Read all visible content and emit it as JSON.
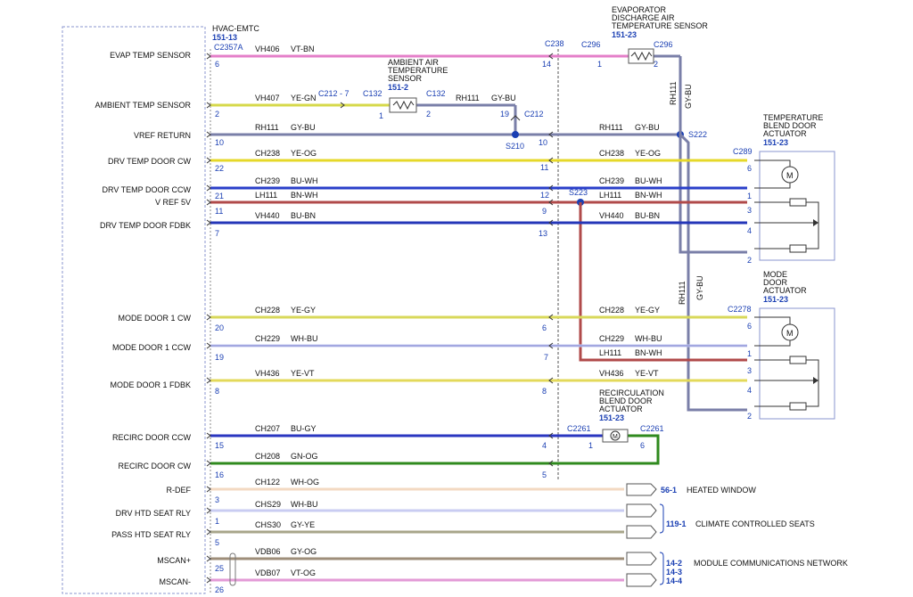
{
  "module": {
    "name": "HVAC-EMTC",
    "ref": "151-13",
    "connector": "C2357A",
    "labels": [
      "EVAP TEMP SENSOR",
      "AMBIENT TEMP SENSOR",
      "VREF RETURN",
      "DRV TEMP DOOR CW",
      "DRV TEMP DOOR CCW",
      "V REF 5V",
      "DRV TEMP DOOR FDBK",
      "MODE DOOR 1 CW",
      "MODE DOOR 1 CCW",
      "MODE DOOR 1 FDBK",
      "RECIRC DOOR CCW",
      "RECIRC DOOR CW",
      "R-DEF",
      "DRV HTD SEAT RLY",
      "PASS HTD SEAT RLY",
      "MSCAN+",
      "MSCAN-"
    ],
    "pins": [
      "6",
      "2",
      "10",
      "22",
      "21",
      "11",
      "7",
      "20",
      "19",
      "8",
      "15",
      "16",
      "3",
      "1",
      "5",
      "25",
      "26"
    ]
  },
  "wires": [
    {
      "circuit": "VH406",
      "color": "VT-BN",
      "hex": "#e47fc9"
    },
    {
      "circuit": "VH407",
      "color": "YE-GN",
      "hex": "#d6d94a"
    },
    {
      "circuit": "RH111",
      "color": "GY-BU",
      "hex": "#7a7fa8"
    },
    {
      "circuit": "CH238",
      "color": "YE-OG",
      "hex": "#e6d829"
    },
    {
      "circuit": "CH239",
      "color": "BU-WH",
      "hex": "#2a3fc9"
    },
    {
      "circuit": "LH111",
      "color": "BN-WH",
      "hex": "#b04a4a"
    },
    {
      "circuit": "VH440",
      "color": "BU-BN",
      "hex": "#2436b8"
    },
    {
      "circuit": "CH228",
      "color": "YE-GY",
      "hex": "#d8d85a"
    },
    {
      "circuit": "CH229",
      "color": "WH-BU",
      "hex": "#c4c8f0"
    },
    {
      "circuit": "VH436",
      "color": "YE-VT",
      "hex": "#e3d95a"
    },
    {
      "circuit": "CH207",
      "color": "BU-GY",
      "hex": "#2a36c0"
    },
    {
      "circuit": "CH208",
      "color": "GN-OG",
      "hex": "#2f8a1e"
    },
    {
      "circuit": "CH122",
      "color": "WH-OG",
      "hex": "#f3d9c2"
    },
    {
      "circuit": "CHS29",
      "color": "WH-BU",
      "hex": "#c9ccf2"
    },
    {
      "circuit": "CHS30",
      "color": "GY-YE",
      "hex": "#a8a68a"
    },
    {
      "circuit": "VDB06",
      "color": "GY-OG",
      "hex": "#9e8e7a"
    },
    {
      "circuit": "VDB07",
      "color": "VT-OG",
      "hex": "#e39ad6"
    }
  ],
  "inline": {
    "c238": "C238",
    "pins": [
      "14",
      "",
      "10",
      "11",
      "12",
      "9",
      "13",
      "6",
      "7",
      "8",
      "4",
      "5"
    ],
    "c296a": "C296",
    "c296b": "C296",
    "c296_pin1": "1",
    "c296_pin2": "2",
    "c212_7": "C212 - 7",
    "c132a": "C132",
    "c132b": "C132",
    "c132_pin1": "1",
    "c132_pin2": "2",
    "rh111_a": "RH111",
    "gybu_a": "GY-BU",
    "pin19": "19",
    "c212": "C212",
    "s210": "S210",
    "s222": "S222",
    "s223": "S223",
    "rh111_b": "RH111",
    "gybu_b": "GY-BU",
    "rh111_v1": "RH111",
    "gybu_v1": "GY-BU",
    "rh111_v2": "RH111",
    "gybu_v2": "GY-BU",
    "c2261a": "C2261",
    "c2261b": "C2261",
    "c2261_pin1": "1",
    "c2261_pin6": "6",
    "c289": "C289",
    "c2278": "C2278"
  },
  "right_wires": [
    {
      "circuit": "CH238",
      "color": "YE-OG"
    },
    {
      "circuit": "CH239",
      "color": "BU-WH"
    },
    {
      "circuit": "LH111",
      "color": "BN-WH"
    },
    {
      "circuit": "VH440",
      "color": "BU-BN"
    },
    {
      "circuit": "CH228",
      "color": "YE-GY"
    },
    {
      "circuit": "CH229",
      "color": "WH-BU"
    },
    {
      "circuit": "LH111",
      "color": "BN-WH"
    },
    {
      "circuit": "VH436",
      "color": "YE-VT"
    }
  ],
  "components": {
    "evap_sensor": {
      "lines": [
        "EVAPORATOR",
        "DISCHARGE AIR",
        "TEMPERATURE SENSOR"
      ],
      "ref": "151-23"
    },
    "ambient_sensor": {
      "lines": [
        "AMBIENT AIR",
        "TEMPERATURE",
        "SENSOR"
      ],
      "ref": "151-2"
    },
    "temp_blend": {
      "lines": [
        "TEMPERATURE",
        "BLEND DOOR",
        "ACTUATOR"
      ],
      "ref": "151-23",
      "pins": [
        "6",
        "1",
        "3",
        "4",
        "2"
      ]
    },
    "mode_door": {
      "lines": [
        "MODE",
        "DOOR",
        "ACTUATOR"
      ],
      "ref": "151-23",
      "pins": [
        "6",
        "1",
        "3",
        "4",
        "2"
      ]
    },
    "recirc": {
      "lines": [
        "RECIRCULATION",
        "BLEND DOOR",
        "ACTUATOR"
      ],
      "ref": "151-23"
    }
  },
  "destinations": [
    {
      "ref": "56-1",
      "label": "HEATED WINDOW"
    },
    {
      "ref": "119-1",
      "label": "CLIMATE CONTROLLED SEATS"
    },
    {
      "ref": "14-2",
      "label": "MODULE COMMUNICATIONS NETWORK"
    },
    {
      "ref": "14-3",
      "label": ""
    },
    {
      "ref": "14-4",
      "label": ""
    }
  ],
  "colors": {
    "link_blue": "#1a3fb3",
    "box_border": "#8a95cf"
  }
}
